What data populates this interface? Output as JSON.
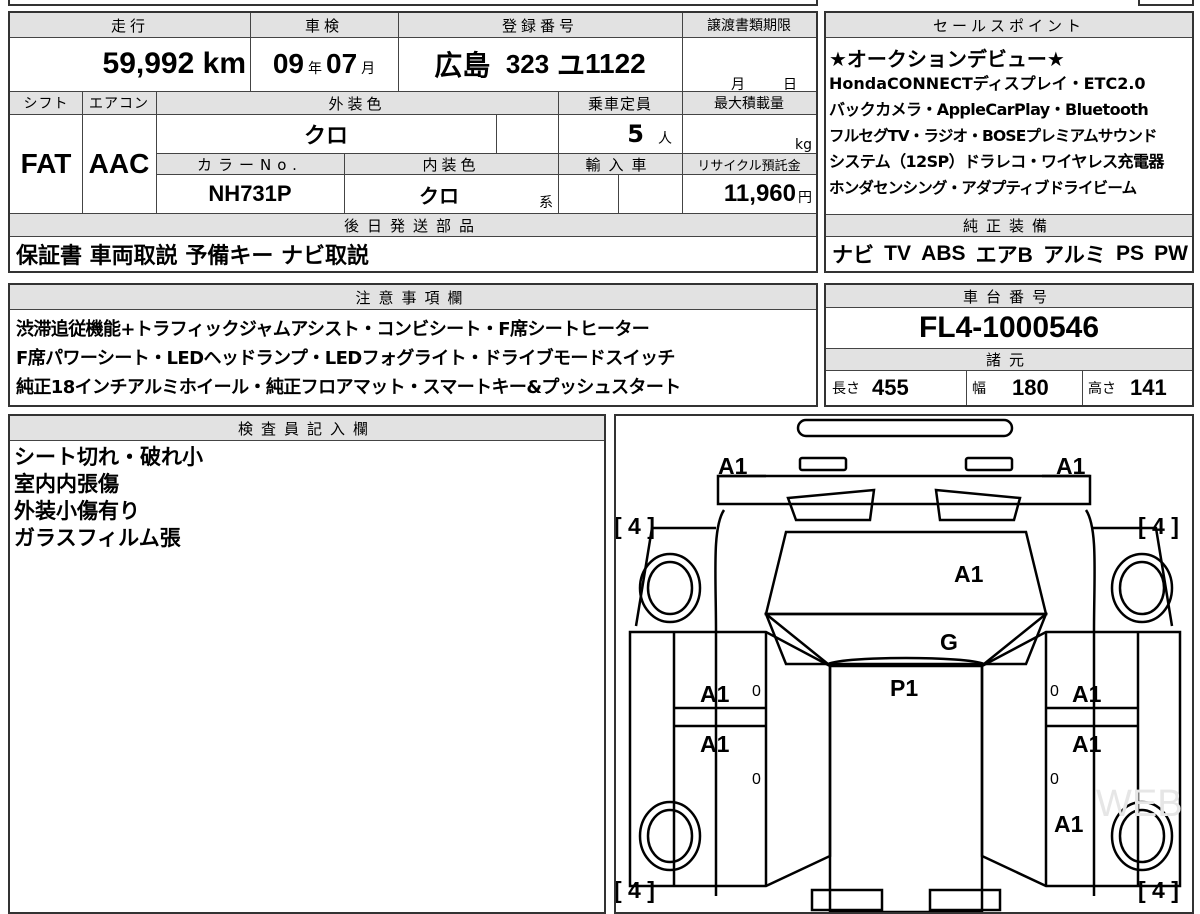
{
  "top": {
    "mileage_header": "走行",
    "mileage": "59,992",
    "mileage_unit": "km",
    "inspection_header": "車検",
    "insp_year": "09",
    "insp_year_unit": "年",
    "insp_month": "07",
    "insp_month_unit": "月",
    "reg_header": "登録番号",
    "reg_area": "広島",
    "reg_class": "323",
    "reg_kana": "ユ",
    "reg_num": "1122",
    "transfer_header": "譲渡書類期限",
    "transfer_month": "月",
    "transfer_day": "日",
    "shift_header": "シフト",
    "shift": "FAT",
    "ac_header": "エアコン",
    "ac": "AAC",
    "exterior_header": "外装色",
    "exterior": "クロ",
    "capacity_header": "乗車定員",
    "capacity": "5",
    "capacity_unit": "人",
    "load_header": "最大積載量",
    "load_unit": "kg",
    "color_no_header": "カラーNo.",
    "color_no": "NH731P",
    "interior_header": "内装色",
    "interior": "クロ",
    "interior_suffix": "系",
    "import_header": "輸入車",
    "recycle_header": "リサイクル預託金",
    "recycle": "11,960",
    "recycle_unit": "円"
  },
  "sales": {
    "header": "セールスポイント",
    "lines": [
      "★オークションデビュー★",
      "HondaCONNECTディスプレイ・ETC2.0",
      "バックカメラ・AppleCarPlay・Bluetooth",
      "フルセグTV・ラジオ・BOSEプレミアムサウンド",
      "システム（12SP）ドラレコ・ワイヤレス充電器",
      "ホンダセンシング・アダプティブドライビーム"
    ]
  },
  "later_parts": {
    "header": "後日発送部品",
    "text": "保証書 車両取説 予備キー ナビ取説"
  },
  "genuine": {
    "header": "純正装備",
    "items": [
      "ナビ",
      "TV",
      "ABS",
      "エアB",
      "アルミ",
      "PS",
      "PW"
    ]
  },
  "notes": {
    "header": "注意事項欄",
    "lines": [
      "渋滞追従機能+トラフィックジャムアシスト・コンビシート・F席シートヒーター",
      "F席パワーシート・LEDヘッドランプ・LEDフォグライト・ドライブモードスイッチ",
      "純正18インチアルミホイール・純正フロアマット・スマートキー&プッシュスタート"
    ]
  },
  "chassis": {
    "header": "車台番号",
    "number": "FL4-1000546"
  },
  "specs": {
    "header": "諸元",
    "length_label": "長さ",
    "length": "455",
    "width_label": "幅",
    "width": "180",
    "height_label": "高さ",
    "height": "141"
  },
  "inspector": {
    "header": "検査員記入欄",
    "lines": [
      "シート切れ・破れ小",
      "室内内張傷",
      "外装小傷有り",
      "ガラスフィルム張"
    ]
  },
  "diagram": {
    "tires": [
      "[ 4 ]",
      "[ 4 ]",
      "[ 4 ]",
      "[ 4 ]"
    ],
    "marks": {
      "front_left": "A1",
      "front_right": "A1",
      "hood": "A1",
      "glass": "G",
      "roof": "P1",
      "left_front_door": "A1",
      "left_rear_door": "A1",
      "right_front_door": "A1",
      "right_rear_door": "A1",
      "right_rear_fender": "A1",
      "door_zero_1": "0",
      "door_zero_2": "0",
      "door_zero_3": "0",
      "door_zero_4": "0"
    },
    "watermark": "WEB STUDIO"
  }
}
